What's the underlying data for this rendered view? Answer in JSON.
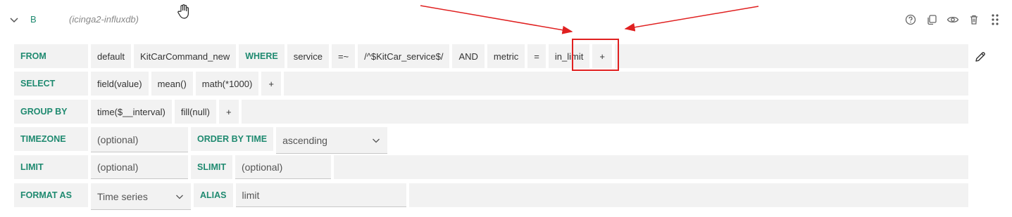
{
  "header": {
    "query_ref": "B",
    "datasource": "(icinga2-influxdb)",
    "icons": [
      "help-icon",
      "duplicate-icon",
      "eye-icon",
      "trash-icon",
      "drag-handle-icon"
    ]
  },
  "from_row": {
    "label": "FROM",
    "policy": "default",
    "measurement": "KitCarCommand_new",
    "where_label": "WHERE",
    "cond1_key": "service",
    "cond1_op": "=~",
    "cond1_value": "/^$KitCar_service$/",
    "and_label": "AND",
    "cond2_key": "metric",
    "cond2_op": "=",
    "cond2_value": "in_limit",
    "add": "+"
  },
  "select_row": {
    "label": "SELECT",
    "field": "field(value)",
    "agg": "mean()",
    "math": "math(*1000)",
    "add": "+"
  },
  "groupby_row": {
    "label": "GROUP BY",
    "time": "time($__interval)",
    "fill": "fill(null)",
    "add": "+"
  },
  "timezone_row": {
    "label": "TIMEZONE",
    "tz_placeholder": "(optional)",
    "order_label": "ORDER BY TIME",
    "order_value": "ascending"
  },
  "limit_row": {
    "label": "LIMIT",
    "limit_placeholder": "(optional)",
    "slimit_label": "SLIMIT",
    "slimit_placeholder": "(optional)"
  },
  "format_row": {
    "label": "FORMAT AS",
    "format_value": "Time series",
    "alias_label": "ALIAS",
    "alias_value": "limit"
  },
  "colors": {
    "keyword": "#1f8a70",
    "segment_bg": "#f2f2f2",
    "highlight": "#e02020"
  }
}
